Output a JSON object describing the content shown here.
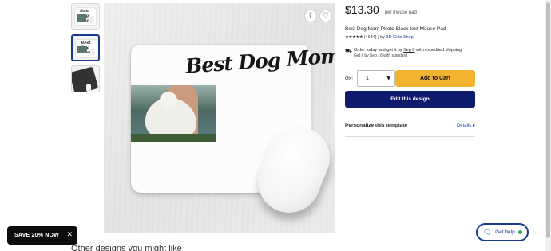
{
  "gallery": {
    "thumbnails": [
      {
        "name": "front-view",
        "active": false,
        "caption": "Best Dog Mom"
      },
      {
        "name": "angled-view",
        "active": true,
        "caption": "Best Dog Mom"
      },
      {
        "name": "dark-view",
        "active": false
      }
    ],
    "main_image": {
      "pad_text": "Best Dog Mom",
      "share_icon": "share-icon",
      "favorite_icon": "heart-icon"
    }
  },
  "product": {
    "price": "$13.30",
    "price_unit": "per mouse pad",
    "title": "Best Dog Mom Photo Black text Mouse Pad",
    "stars": "★★★★★",
    "rating_count": "(4634)",
    "by_prefix": "| by",
    "shop_name": "3D Gifts Shop",
    "shipping_text_pre": "Order today and get it by",
    "shipping_date": "Sep 8",
    "shipping_text_post": "with expedited shipping",
    "shipping_sub": "Get it by Sep 16 with standard",
    "qty_label": "Qty:",
    "qty_value": "1",
    "add_to_cart": "Add to Cart",
    "edit_design": "Edit this design",
    "personalize_label": "Personalize this template",
    "details_link": "Details ▸"
  },
  "promo": {
    "label": "SAVE 20% NOW",
    "close": "✕"
  },
  "help": {
    "label": "Get help"
  },
  "footer": {
    "other_designs": "Other designs you might like"
  },
  "colors": {
    "accent_cart": "#f2b42e",
    "accent_edit": "#0e1a6b",
    "link": "#1a4aa8",
    "online": "#2fa24c"
  }
}
